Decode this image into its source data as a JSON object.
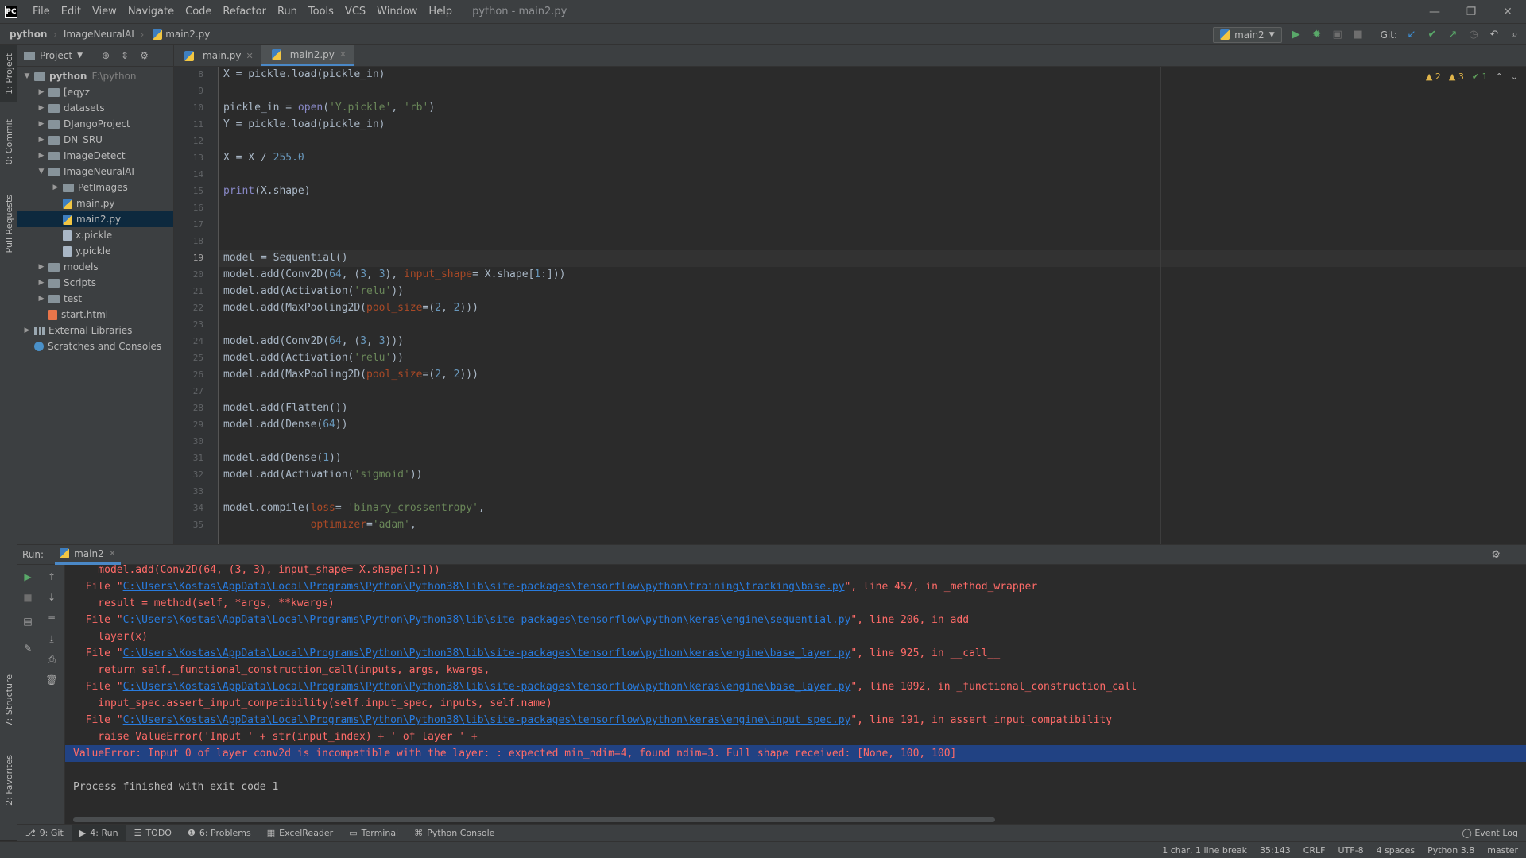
{
  "titlebar": {
    "logo": "PC",
    "menu": [
      "File",
      "Edit",
      "View",
      "Navigate",
      "Code",
      "Refactor",
      "Run",
      "Tools",
      "VCS",
      "Window",
      "Help"
    ],
    "window_title": "python - main2.py"
  },
  "breadcrumbs": [
    "python",
    "ImageNeuralAI",
    "main2.py"
  ],
  "toolbar": {
    "run_config": "main2",
    "git_label": "Git:"
  },
  "left_strip": {
    "project": "1: Project",
    "commit": "0: Commit",
    "pull_requests": "Pull Requests",
    "structure": "7: Structure",
    "favorites": "2: Favorites"
  },
  "project_panel": {
    "title": "Project",
    "tree": [
      {
        "label": "python",
        "extra": "F:\\python",
        "depth": 0,
        "type": "folder",
        "expanded": true
      },
      {
        "label": "[eqyz",
        "depth": 1,
        "type": "folder"
      },
      {
        "label": "datasets",
        "depth": 1,
        "type": "folder"
      },
      {
        "label": "DJangoProject",
        "depth": 1,
        "type": "folder"
      },
      {
        "label": "DN_SRU",
        "depth": 1,
        "type": "folder"
      },
      {
        "label": "ImageDetect",
        "depth": 1,
        "type": "folder"
      },
      {
        "label": "ImageNeuralAI",
        "depth": 1,
        "type": "folder",
        "expanded": true
      },
      {
        "label": "PetImages",
        "depth": 2,
        "type": "folder"
      },
      {
        "label": "main.py",
        "depth": 2,
        "type": "py"
      },
      {
        "label": "main2.py",
        "depth": 2,
        "type": "py",
        "selected": true
      },
      {
        "label": "x.pickle",
        "depth": 2,
        "type": "file"
      },
      {
        "label": "y.pickle",
        "depth": 2,
        "type": "file"
      },
      {
        "label": "models",
        "depth": 1,
        "type": "folder"
      },
      {
        "label": "Scripts",
        "depth": 1,
        "type": "folder"
      },
      {
        "label": "test",
        "depth": 1,
        "type": "folder"
      },
      {
        "label": "start.html",
        "depth": 1,
        "type": "html"
      },
      {
        "label": "External Libraries",
        "depth": 0,
        "type": "lib"
      },
      {
        "label": "Scratches and Consoles",
        "depth": 0,
        "type": "scratch"
      }
    ]
  },
  "editor_tabs": [
    {
      "label": "main.py",
      "active": false
    },
    {
      "label": "main2.py",
      "active": true
    }
  ],
  "inspections": {
    "warnings_a": "2",
    "warnings_b": "3",
    "ok": "1"
  },
  "editor": {
    "caret_line": "19",
    "lines": [
      {
        "n": "8",
        "html": "X = pickle.load(pickle_in)"
      },
      {
        "n": "9",
        "html": ""
      },
      {
        "n": "10",
        "html": "pickle_in = <span class='builtin'>open</span>(<span class='str'>'Y.pickle'</span>, <span class='str'>'rb'</span>)"
      },
      {
        "n": "11",
        "html": "Y = pickle.load(pickle_in)"
      },
      {
        "n": "12",
        "html": ""
      },
      {
        "n": "13",
        "html": "X = X / <span class='num'>255.0</span>"
      },
      {
        "n": "14",
        "html": ""
      },
      {
        "n": "15",
        "html": "<span class='builtin'>print</span>(X.shape)"
      },
      {
        "n": "16",
        "html": ""
      },
      {
        "n": "17",
        "html": ""
      },
      {
        "n": "18",
        "html": ""
      },
      {
        "n": "19",
        "html": "model = Sequential()"
      },
      {
        "n": "20",
        "html": "model.add(Conv2D(<span class='num'>64</span>, (<span class='num'>3</span>, <span class='num'>3</span>), <span class='param'>input_shape</span>= X.shape[<span class='num'>1</span>:]))"
      },
      {
        "n": "21",
        "html": "model.add(Activation(<span class='str'>'relu'</span>))"
      },
      {
        "n": "22",
        "html": "model.add(MaxPooling2D(<span class='param'>pool_size</span>=(<span class='num'>2</span>, <span class='num'>2</span>)))"
      },
      {
        "n": "23",
        "html": ""
      },
      {
        "n": "24",
        "html": "model.add(Conv2D(<span class='num'>64</span>, (<span class='num'>3</span>, <span class='num'>3</span>)))"
      },
      {
        "n": "25",
        "html": "model.add(Activation(<span class='str'>'relu'</span>))"
      },
      {
        "n": "26",
        "html": "model.add(MaxPooling2D(<span class='param'>pool_size</span>=(<span class='num'>2</span>, <span class='num'>2</span>)))"
      },
      {
        "n": "27",
        "html": ""
      },
      {
        "n": "28",
        "html": "model.add(Flatten())"
      },
      {
        "n": "29",
        "html": "model.add(Dense(<span class='num'>64</span>))"
      },
      {
        "n": "30",
        "html": ""
      },
      {
        "n": "31",
        "html": "model.add(Dense(<span class='num'>1</span>))"
      },
      {
        "n": "32",
        "html": "model.add(Activation(<span class='str'>'sigmoid'</span>))"
      },
      {
        "n": "33",
        "html": ""
      },
      {
        "n": "34",
        "html": "model.compile(<span class='param'>loss</span>= <span class='str'>'binary_crossentropy'</span>,"
      },
      {
        "n": "35",
        "html": "              <span class='param'>optimizer</span>=<span class='str'>'adam'</span>,"
      }
    ]
  },
  "run_panel": {
    "label": "Run:",
    "tab": "main2",
    "console": [
      {
        "type": "err",
        "html": "    model.add(Conv2D(64, (3, 3), input_shape= X.shape[1:]))"
      },
      {
        "type": "err",
        "html": "  File \"<a>C:\\Users\\Kostas\\AppData\\Local\\Programs\\Python\\Python38\\lib\\site-packages\\tensorflow\\python\\training\\tracking\\base.py</a>\", line 457, in _method_wrapper"
      },
      {
        "type": "err",
        "html": "    result = method(self, *args, **kwargs)"
      },
      {
        "type": "err",
        "html": "  File \"<a>C:\\Users\\Kostas\\AppData\\Local\\Programs\\Python\\Python38\\lib\\site-packages\\tensorflow\\python\\keras\\engine\\sequential.py</a>\", line 206, in add"
      },
      {
        "type": "err",
        "html": "    layer(x)"
      },
      {
        "type": "err",
        "html": "  File \"<a>C:\\Users\\Kostas\\AppData\\Local\\Programs\\Python\\Python38\\lib\\site-packages\\tensorflow\\python\\keras\\engine\\base_layer.py</a>\", line 925, in __call__"
      },
      {
        "type": "err",
        "html": "    return self._functional_construction_call(inputs, args, kwargs,"
      },
      {
        "type": "err",
        "html": "  File \"<a>C:\\Users\\Kostas\\AppData\\Local\\Programs\\Python\\Python38\\lib\\site-packages\\tensorflow\\python\\keras\\engine\\base_layer.py</a>\", line 1092, in _functional_construction_call"
      },
      {
        "type": "err",
        "html": "    input_spec.assert_input_compatibility(self.input_spec, inputs, self.name)"
      },
      {
        "type": "err",
        "html": "  File \"<a>C:\\Users\\Kostas\\AppData\\Local\\Programs\\Python\\Python38\\lib\\site-packages\\tensorflow\\python\\keras\\engine\\input_spec.py</a>\", line 191, in assert_input_compatibility"
      },
      {
        "type": "err",
        "html": "    raise ValueError('Input ' + str(input_index) + ' of layer ' +"
      },
      {
        "type": "err-hl",
        "html": "ValueError: Input 0 of layer conv2d is incompatible with the layer: : expected min_ndim=4, found ndim=3. Full shape received: [None, 100, 100]"
      },
      {
        "type": "plain",
        "html": ""
      },
      {
        "type": "plain",
        "html": "Process finished with exit code 1"
      }
    ]
  },
  "bottom_tabs": [
    {
      "label": "9: Git",
      "active": false
    },
    {
      "label": "4: Run",
      "active": true
    },
    {
      "label": "TODO",
      "active": false
    },
    {
      "label": "6: Problems",
      "active": false
    },
    {
      "label": "ExcelReader",
      "active": false
    },
    {
      "label": "Terminal",
      "active": false
    },
    {
      "label": "Python Console",
      "active": false
    }
  ],
  "event_log": "Event Log",
  "status_bar": [
    "1 char, 1 line break",
    "35:143",
    "CRLF",
    "UTF-8",
    "4 spaces",
    "Python 3.8",
    "master"
  ]
}
